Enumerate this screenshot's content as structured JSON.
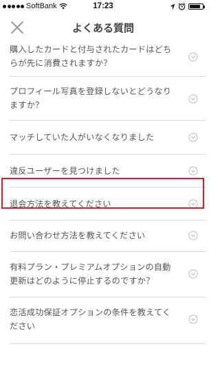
{
  "status_bar": {
    "carrier": "SoftBank",
    "time": "17:23",
    "battery_level": 0.85,
    "icons": [
      "signal-icon",
      "wifi-icon",
      "location-icon",
      "alarm-icon",
      "battery-icon"
    ]
  },
  "header": {
    "title": "よくある質問",
    "close_icon": "close-icon"
  },
  "faq": {
    "items": [
      {
        "line1": "購入したカードと付与されたカードはどち",
        "line2": "らが先に消費されますか？"
      },
      {
        "line1": "プロフィール写真を登録しないとどうなり",
        "line2": "ますか？"
      },
      {
        "line1": "マッチしていた人がいなくなりました",
        "line2": ""
      },
      {
        "line1": "違反ユーザーを見つけました",
        "line2": ""
      },
      {
        "line1": "退会方法を教えてください",
        "line2": ""
      },
      {
        "line1": "お問い合わせ方法を教えてください",
        "line2": ""
      },
      {
        "line1": "有料プラン・プレミアムオプションの自動",
        "line2": "更新はどのように停止するのですか？"
      },
      {
        "line1": "恋活成功保証オプションの条件を教えてく",
        "line2": "ださい"
      }
    ],
    "chevron_icon": "chevron-down-circle-icon",
    "highlighted_index": 4
  },
  "colors": {
    "highlight": "#e8141e",
    "text": "#555555",
    "divider": "#dddddd"
  }
}
